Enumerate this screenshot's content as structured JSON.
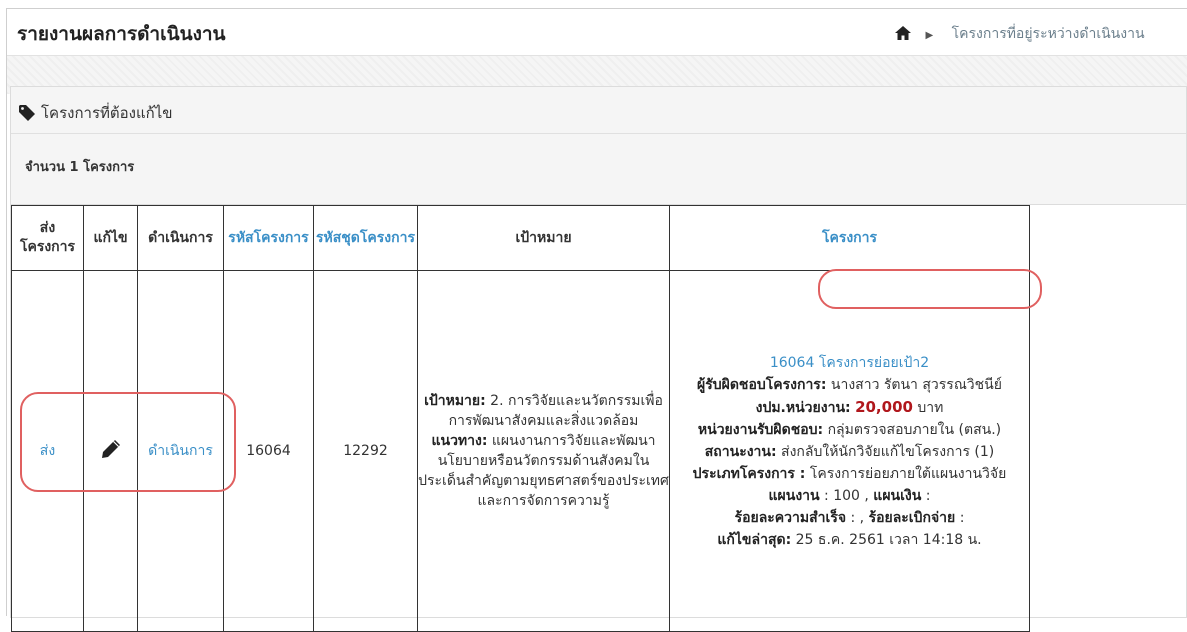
{
  "header": {
    "title": "รายงานผลการดำเนินงาน",
    "breadcrumb": "โครงการที่อยู่ระหว่างดำเนินงาน"
  },
  "panel": {
    "title": "โครงการที่ต้องแก้ไข",
    "count": "จำนวน 1 โครงการ"
  },
  "table": {
    "headers": {
      "send": "ส่งโครงการ",
      "edit": "แก้ไข",
      "action": "ดำเนินการ",
      "project_code": "รหัสโครงการ",
      "series_code": "รหัสชุดโครงการ",
      "goal": "เป้าหมาย",
      "project": "โครงการ"
    },
    "row": {
      "send_link": "ส่ง",
      "action_link": "ดำเนินการ",
      "project_code": "16064",
      "series_code": "12292",
      "goal_label": "เป้าหมาย:",
      "goal_text": "2. การวิจัยและนวัตกรรมเพื่อการพัฒนาสังคมและสิ่งแวดล้อม",
      "approach_label": "แนวทาง:",
      "approach_text": "แผนงานการวิจัยและพัฒนานโยบายหรือนวัตกรรมด้านสังคมในประเด็นสำคัญตามยุทธศาสตร์ของประเทศ และการจัดการความรู้",
      "project_link": "16064 โครงการย่อยเป้า2",
      "owner_label": "ผู้รับผิดชอบโครงการ:",
      "owner_text": "นางสาว รัตนา สุวรรณวิชนีย์",
      "budget_label": "งปม.หน่วยงาน:",
      "budget_value": "20,000",
      "budget_unit": "บาท",
      "unit_label": "หน่วยงานรับผิดชอบ:",
      "unit_text": "กลุ่มตรวจสอบภายใน (ตสน.)",
      "status_label": "สถานะงาน:",
      "status_text": "ส่งกลับให้นักวิจัยแก้ไขโครงการ (1)",
      "type_label": "ประเภทโครงการ :",
      "type_text": "โครงการย่อยภายใต้แผนงานวิจัย",
      "plan_label": "แผนงาน",
      "plan_value": ": 100 ,",
      "money_label": "แผนเงิน",
      "money_value": ":",
      "success_label": "ร้อยละความสำเร็จ",
      "success_value": ": ,",
      "spend_label": "ร้อยละเบิกจ่าย",
      "spend_value": ":",
      "updated_label": "แก้ไขล่าสุด:",
      "updated_text": "25 ธ.ค. 2561 เวลา 14:18 น."
    }
  },
  "colors": {
    "link": "#3a8fc7",
    "budget": "#b0171c",
    "highlight": "#e06060"
  },
  "icons": [
    "home-icon",
    "chevron-right-icon",
    "tag-icon",
    "pencil-icon"
  ]
}
